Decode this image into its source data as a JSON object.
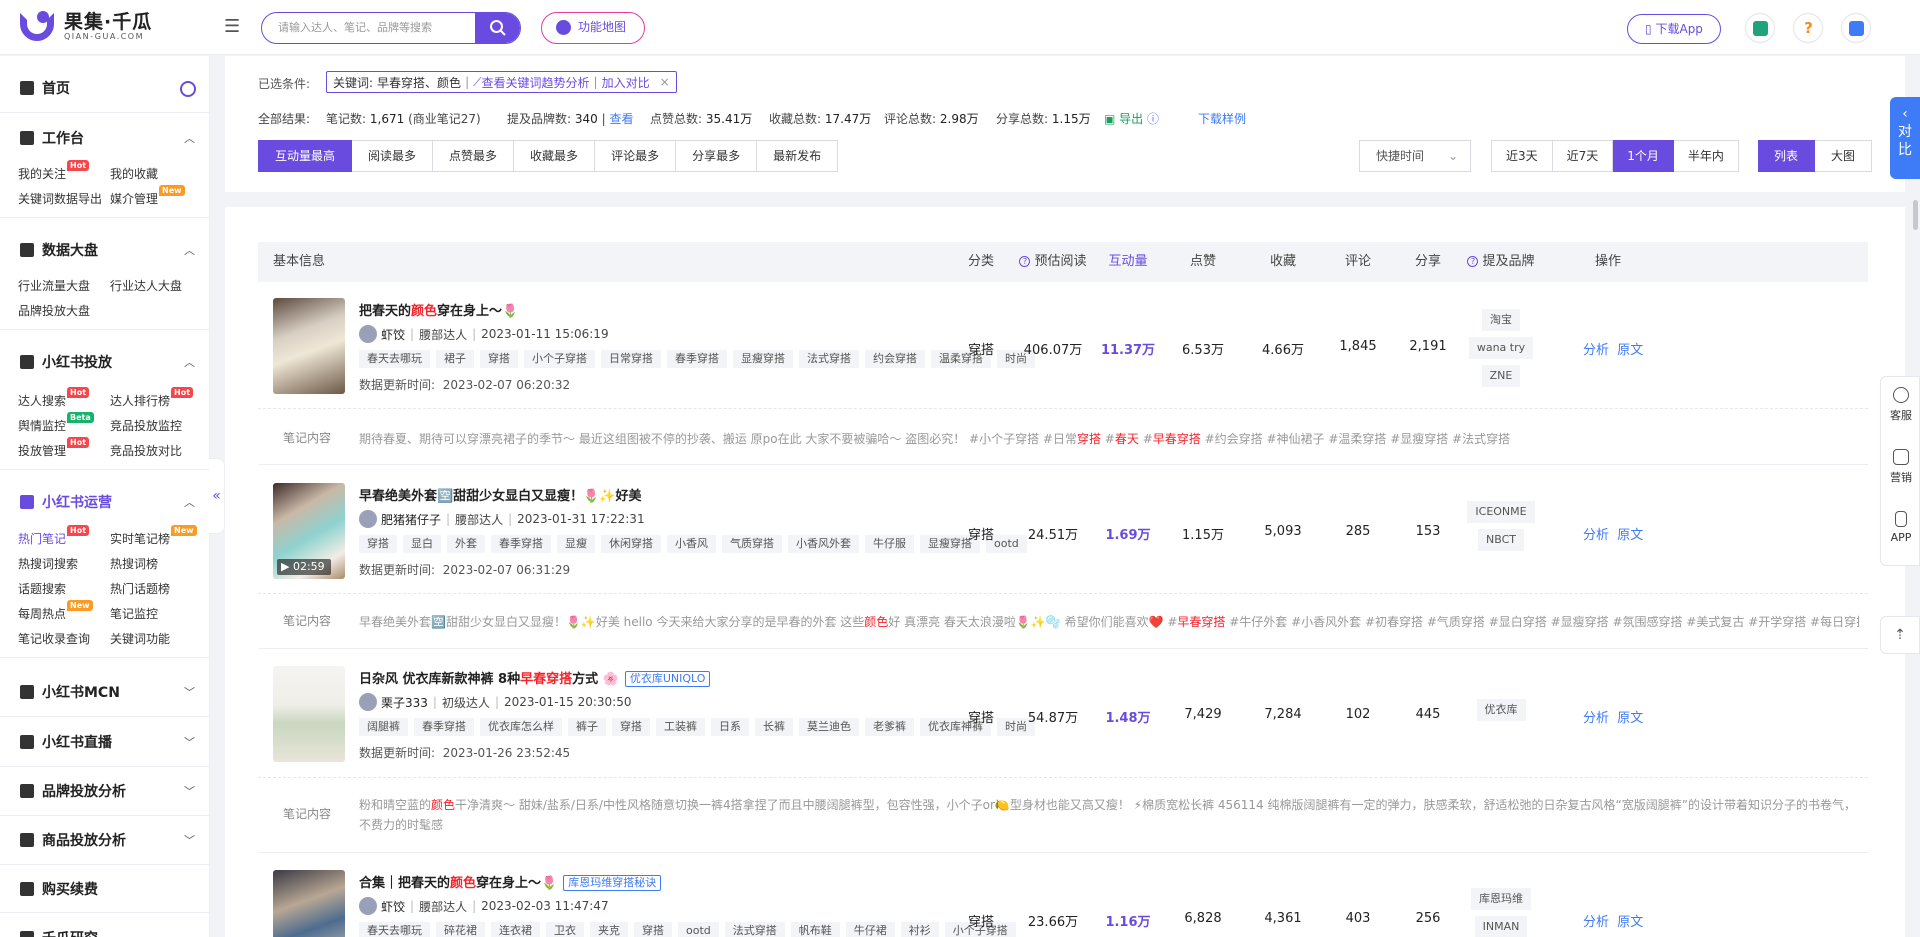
{
  "header": {
    "logo_cn": "果集·千瓜",
    "logo_en": "QIAN-GUA.COM",
    "search_placeholder": "请输入达人、笔记、品牌等搜索",
    "function_map": "功能地图",
    "download_app": "下载App"
  },
  "sidebar": {
    "home": "首页",
    "sections": [
      {
        "title": "工作台",
        "items": [
          {
            "label": "我的关注",
            "tag": "Hot"
          },
          {
            "label": "我的收藏"
          },
          {
            "label": "关键词数据导出"
          },
          {
            "label": "媒介管理",
            "tag": "New"
          }
        ]
      },
      {
        "title": "数据大盘",
        "items": [
          {
            "label": "行业流量大盘"
          },
          {
            "label": "行业达人大盘"
          },
          {
            "label": "品牌投放大盘"
          }
        ]
      },
      {
        "title": "小红书投放",
        "items": [
          {
            "label": "达人搜索",
            "tag": "Hot"
          },
          {
            "label": "达人排行榜",
            "tag": "Hot"
          },
          {
            "label": "舆情监控",
            "tag": "Beta"
          },
          {
            "label": "竞品投放监控"
          },
          {
            "label": "投放管理",
            "tag": "Hot"
          },
          {
            "label": "竞品投放对比"
          }
        ]
      },
      {
        "title": "小红书运营",
        "items": [
          {
            "label": "热门笔记",
            "tag": "Hot"
          },
          {
            "label": "实时笔记榜",
            "tag": "New"
          },
          {
            "label": "热搜词搜索"
          },
          {
            "label": "热搜词榜"
          },
          {
            "label": "话题搜索"
          },
          {
            "label": "热门话题榜"
          },
          {
            "label": "每周热点",
            "tag": "New"
          },
          {
            "label": "笔记监控"
          },
          {
            "label": "笔记收录查询"
          },
          {
            "label": "关键词功能"
          }
        ]
      },
      {
        "title": "小红书MCN"
      },
      {
        "title": "小红书直播"
      },
      {
        "title": "品牌投放分析"
      },
      {
        "title": "商品投放分析"
      },
      {
        "title": "购买续费"
      },
      {
        "title": "千瓜研究"
      }
    ]
  },
  "filter": {
    "selected_label": "已选条件:",
    "keyword_label": "关键词:",
    "keyword": "早春穿搭、颜色",
    "trend_link": "查看关键词趋势分析",
    "compare_link": "加入对比",
    "close": "×",
    "result_label": "全部结果:",
    "notes_count_label": "笔记数:",
    "notes_count": "1,671",
    "commercial": "(商业笔记27)",
    "brand_count_label": "提及品牌数:",
    "brand_count": "340",
    "view": "查看",
    "likes_label": "点赞总数:",
    "likes_total": "35.41万",
    "collect_label": "收藏总数:",
    "collect_total": "17.47万",
    "comment_label": "评论总数:",
    "comment_total": "2.98万",
    "share_label": "分享总数:",
    "share_total": "1.15万",
    "export": "导出",
    "download_sample": "下载样例",
    "sort_tabs": [
      "互动量最高",
      "阅读最多",
      "点赞最多",
      "收藏最多",
      "评论最多",
      "分享最多",
      "最新发布"
    ],
    "quick_time": "快捷时间",
    "ranges": [
      "近3天",
      "近7天",
      "1个月",
      "半年内"
    ],
    "views": [
      "列表",
      "大图"
    ]
  },
  "table": {
    "headers": {
      "basic": "基本信息",
      "category": "分类",
      "est_read": "预估阅读",
      "interaction": "互动量",
      "likes": "点赞",
      "collects": "收藏",
      "comments": "评论",
      "shares": "分享",
      "brands": "提及品牌",
      "ops": "操作"
    },
    "note_label": "笔记内容",
    "update_label": "数据更新时间:",
    "analyze": "分析",
    "origin": "原文",
    "rows": [
      {
        "title_pre": "把春天的",
        "title_hl": "颜色",
        "title_post": "穿在身上～🌷",
        "brand_tag": "",
        "author": "虾饺",
        "level": "腰部达人",
        "time": "2023-01-11 15:06:19",
        "tags": [
          "春天去哪玩",
          "裙子",
          "穿搭",
          "小个子穿搭",
          "日常穿搭",
          "春季穿搭",
          "显瘦穿搭",
          "法式穿搭",
          "约会穿搭",
          "温柔穿搭",
          "时尚"
        ],
        "updated": "2023-02-07 06:20:32",
        "category": "穿搭",
        "est_read": "406.07万",
        "interaction": "11.37万",
        "likes": "6.53万",
        "collects": "4.66万",
        "comments": "1,845",
        "shares": "2,191",
        "brands": [
          "淘宝",
          "wana try",
          "ZNE"
        ],
        "note_a": "期待春夏、期待可以穿漂亮裙子的季节～ 最近这组图被不停的抄袭、搬运 原po在此 大家不要被骗哈～ 盗图必究！ #小个子穿搭 #日常",
        "note_b": "穿搭",
        "note_c": " #",
        "note_d": "春天",
        "note_e": " #",
        "note_f": "早春穿搭",
        "note_g": " #约会穿搭 #神仙裙子 #温柔穿搭 #显瘦穿搭 #法式穿搭"
      },
      {
        "title_pre": "早春绝美外套🈳甜甜少女显白又显瘦！🌷✨好美",
        "title_hl": "",
        "title_post": "",
        "brand_tag": "",
        "video": "02:59",
        "author": "肥猪猪仔子",
        "level": "腰部达人",
        "time": "2023-01-31 17:22:31",
        "tags": [
          "穿搭",
          "显白",
          "外套",
          "春季穿搭",
          "显瘦",
          "休闲穿搭",
          "小香风",
          "气质穿搭",
          "小香风外套",
          "牛仔服",
          "显瘦穿搭",
          "ootd"
        ],
        "updated": "2023-02-07 06:31:29",
        "category": "穿搭",
        "est_read": "24.51万",
        "interaction": "1.69万",
        "likes": "1.15万",
        "collects": "5,093",
        "comments": "285",
        "shares": "153",
        "brands": [
          "ICEONME",
          "NBCT"
        ],
        "note_a": "早春绝美外套🈳甜甜少女显白又显瘦！🌷✨好美 hello 今天来给大家分享的是早春的外套 这些",
        "note_b": "颜色",
        "note_c": "好 真漂亮 春天太浪漫啦🌷✨🫧 希望你们能喜欢❤️ #",
        "note_d": "早春穿搭",
        "note_e": "",
        "note_f": "",
        "note_g": " #牛仔外套 #小香风外套 #初春穿搭 #气质穿搭 #显白穿搭 #显瘦穿搭 #氛围感穿搭 #美式复古 #开学穿搭 #每日穿搭"
      },
      {
        "title_pre": "日杂风 优衣库新款神裤 8种",
        "title_hl": "早春穿搭",
        "title_post": "方式 🌸",
        "brand_tag": "优衣库UNIQLO",
        "author": "栗子333",
        "level": "初级达人",
        "time": "2023-01-15 20:30:50",
        "tags": [
          "阔腿裤",
          "春季穿搭",
          "优衣库怎么样",
          "裤子",
          "穿搭",
          "工装裤",
          "日系",
          "长裤",
          "莫兰迪色",
          "老爹裤",
          "优衣库神裤",
          "时尚"
        ],
        "updated": "2023-01-26 23:52:45",
        "category": "穿搭",
        "est_read": "54.87万",
        "interaction": "1.48万",
        "likes": "7,429",
        "collects": "7,284",
        "comments": "102",
        "shares": "445",
        "brands": [
          "优衣库"
        ],
        "note_a": "粉和晴空蓝的",
        "note_b": "颜色",
        "note_c": "干净清爽～ 甜妹/盐系/日系/中性风格随意切换一裤4搭拿捏了而且中腰阔腿裤型，包容性强，小个子or🍋型身材也能又高又瘦！ ⚡棉质宽松长裤 456114 纯棉版阔腿裤有一定的弹力，肤感柔软，舒适松弛的日杂复古风格“宽版阔腿裤”的设计带着知识分子的书卷气，不费力的时髦感",
        "note_d": "",
        "note_e": "",
        "note_f": "",
        "note_g": ""
      },
      {
        "title_pre": "合集｜把春天的",
        "title_hl": "颜色",
        "title_post": "穿在身上～🌷",
        "brand_tag": "库恩玛维穿搭秘诀",
        "author": "虾饺",
        "level": "腰部达人",
        "time": "2023-02-03 11:47:47",
        "tags": [
          "春天去哪玩",
          "碎花裙",
          "连衣裙",
          "卫衣",
          "夹克",
          "穿搭",
          "ootd",
          "法式穿搭",
          "帆布鞋",
          "牛仔裙",
          "衬衫",
          "小个子穿搭"
        ],
        "updated": "",
        "category": "穿搭",
        "est_read": "23.66万",
        "interaction": "1.16万",
        "likes": "6,828",
        "collects": "4,361",
        "comments": "403",
        "shares": "256",
        "brands": [
          "库恩玛维",
          "INMAN"
        ]
      }
    ]
  },
  "right": {
    "compare": "对比",
    "service": "客服",
    "marketing": "营销",
    "app": "APP"
  },
  "colors": {
    "accent": "#6a4be0",
    "link": "#3e7bf6",
    "highlight": "#f5232b"
  }
}
